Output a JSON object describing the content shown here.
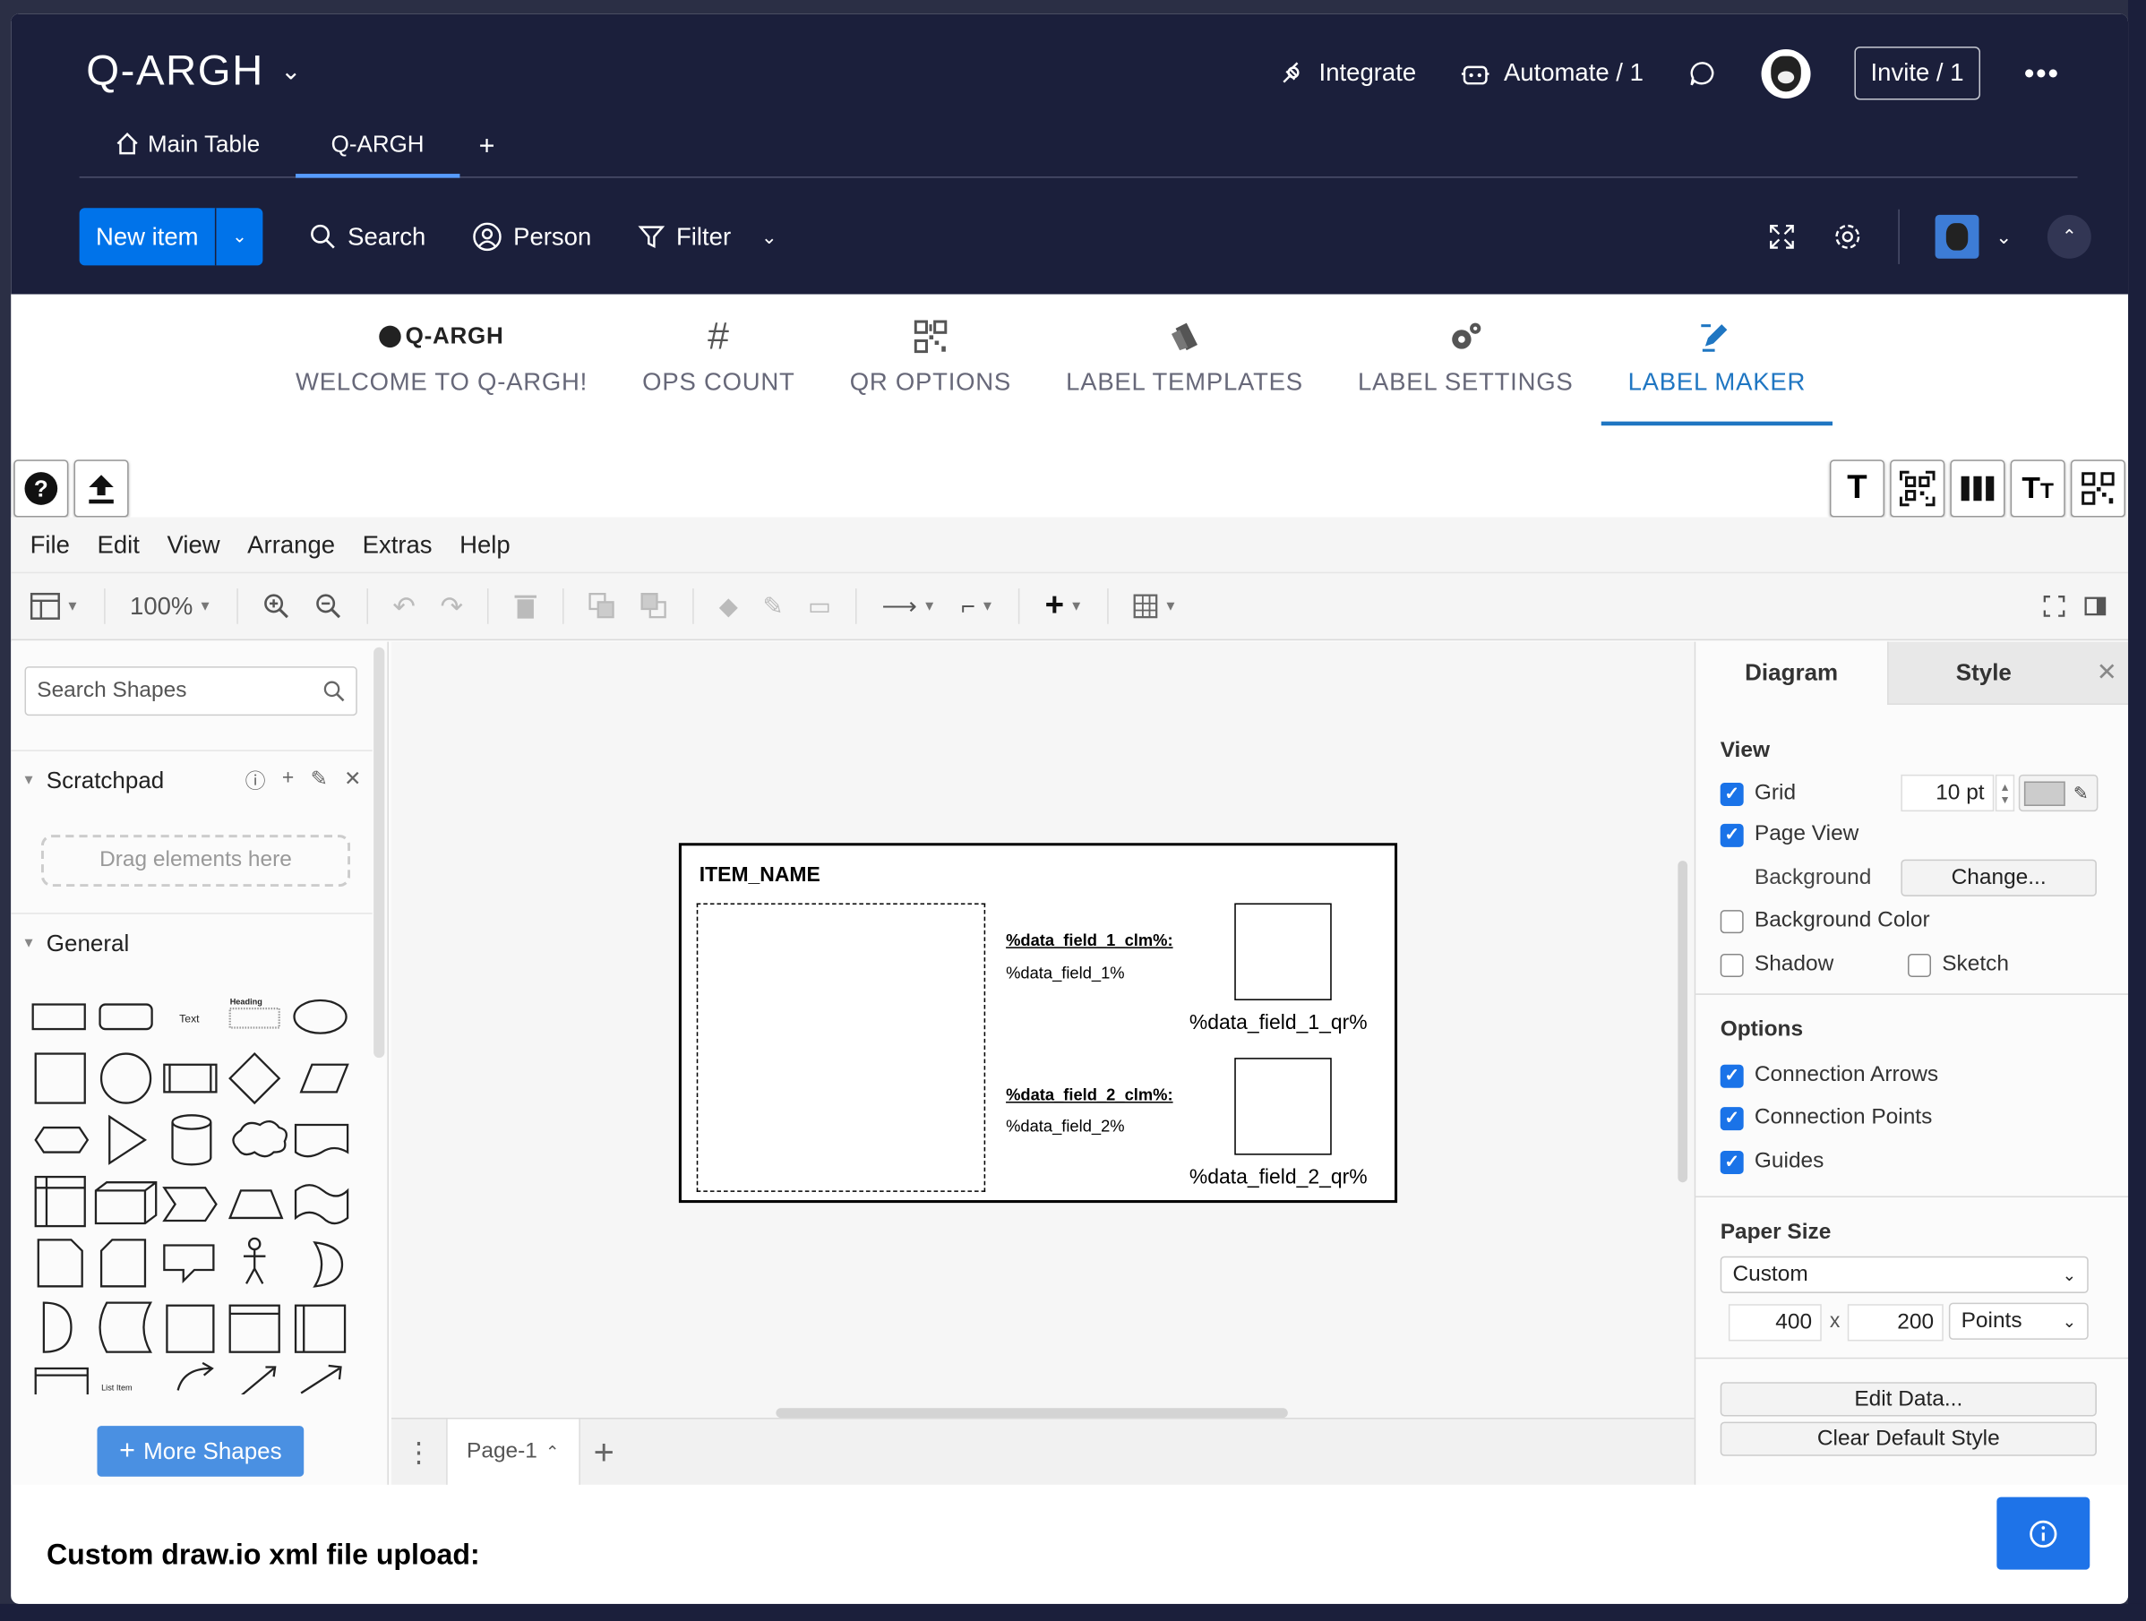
{
  "header": {
    "board_title": "Q-ARGH",
    "integrate": "Integrate",
    "automate": "Automate / 1",
    "invite": "Invite / 1",
    "more": "•••",
    "tabs": [
      {
        "label": "Main Table"
      },
      {
        "label": "Q-ARGH"
      }
    ],
    "add_tab": "+"
  },
  "toolbar": {
    "new_item": "New item",
    "search": "Search",
    "person": "Person",
    "filter": "Filter"
  },
  "app_nav": [
    {
      "label": "WELCOME TO Q-ARGH!",
      "icon": "q-argh-logo",
      "logo_text": "Q-ARGH"
    },
    {
      "label": "OPS COUNT",
      "icon": "hash-icon"
    },
    {
      "label": "QR OPTIONS",
      "icon": "qr-icon"
    },
    {
      "label": "LABEL TEMPLATES",
      "icon": "tags-icon"
    },
    {
      "label": "LABEL SETTINGS",
      "icon": "gears-icon"
    },
    {
      "label": "LABEL MAKER",
      "icon": "pen-icon"
    }
  ],
  "active_nav": "LABEL MAKER",
  "drawio": {
    "menu": [
      "File",
      "Edit",
      "View",
      "Arrange",
      "Extras",
      "Help"
    ],
    "zoom": "100%",
    "search_placeholder": "Search Shapes",
    "scratchpad": "Scratchpad",
    "dropzone": "Drag elements here",
    "general": "General",
    "more_shapes": "More Shapes",
    "page_name": "Page-1",
    "label": {
      "item_name": "ITEM_NAME",
      "field1_clm": "%data_field_1_clm%:",
      "field1_val": "%data_field_1%",
      "field1_qr": "%data_field_1_qr%",
      "field2_clm": "%data_field_2_clm%:",
      "field2_val": "%data_field_2%",
      "field2_qr": "%data_field_2_qr%"
    },
    "panel": {
      "tab_diagram": "Diagram",
      "tab_style": "Style",
      "view_heading": "View",
      "grid": "Grid",
      "grid_size": "10 pt",
      "page_view": "Page View",
      "background": "Background",
      "change": "Change...",
      "background_color": "Background Color",
      "shadow": "Shadow",
      "sketch": "Sketch",
      "options_heading": "Options",
      "connection_arrows": "Connection Arrows",
      "connection_points": "Connection Points",
      "guides": "Guides",
      "paper_size_heading": "Paper Size",
      "paper_size": "Custom",
      "width": "400",
      "x": "x",
      "height": "200",
      "units": "Points",
      "edit_data": "Edit Data...",
      "clear_default_style": "Clear Default Style"
    }
  },
  "footer": {
    "title": "Custom draw.io xml file upload:"
  },
  "colors": {
    "header_bg": "#1b1f3b",
    "primary": "#0073ea",
    "active_tab": "#1f76c2",
    "checkbox": "#1a73e8"
  }
}
